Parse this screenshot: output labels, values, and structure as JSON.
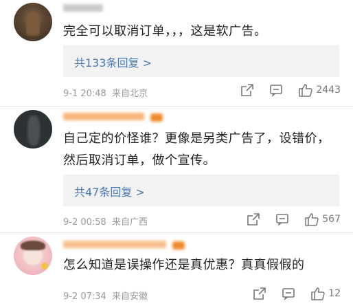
{
  "comments": [
    {
      "text": "完全可以取消订单，，，这是软广告。",
      "replies": "共133条回复 >",
      "time": "9-1 20:48",
      "location": "来自北京",
      "likes": "2443"
    },
    {
      "text": "自己定的价怪谁？更像是另类广告了，设错价，然后取消订单，做个宣传。",
      "replies": "共47条回复 >",
      "time": "9-2 00:58",
      "location": "来自广西",
      "likes": "567"
    },
    {
      "text": "怎么知道是误操作还是真优惠？真真假假的",
      "time": "9-2 07:34",
      "location": "来自安徽",
      "likes": "12"
    }
  ],
  "icons": {
    "share": "share-icon",
    "comment": "comment-icon",
    "like": "thumbs-up-icon",
    "badge": "fan-badge-icon"
  },
  "colors": {
    "link": "#4a79b1",
    "meta": "#9a9a9a",
    "reply_bg": "#f2f2f2",
    "badge": "#f08b2e"
  }
}
